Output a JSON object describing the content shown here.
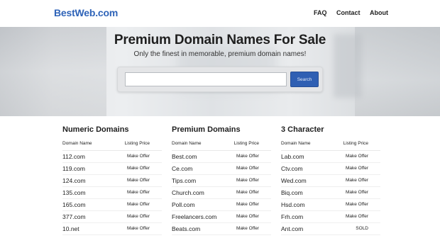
{
  "nav": {
    "logo": "BestWeb.com",
    "links": [
      "FAQ",
      "Contact",
      "About"
    ]
  },
  "hero": {
    "title": "Premium Domain Names For Sale",
    "subtitle": "Only the finest in memorable, premium domain names!",
    "search": {
      "value": "",
      "placeholder": "",
      "button": "Search"
    }
  },
  "columns": [
    {
      "title": "Numeric Domains",
      "header": {
        "name": "Domain Name",
        "price": "Listing Price"
      },
      "rows": [
        {
          "name": "112.com",
          "price": "Make Offer"
        },
        {
          "name": "119.com",
          "price": "Make Offer"
        },
        {
          "name": "124.com",
          "price": "Make Offer"
        },
        {
          "name": "135.com",
          "price": "Make Offer"
        },
        {
          "name": "165.com",
          "price": "Make Offer"
        },
        {
          "name": "377.com",
          "price": "Make Offer"
        },
        {
          "name": "10.net",
          "price": "Make Offer"
        }
      ]
    },
    {
      "title": "Premium Domains",
      "header": {
        "name": "Domain Name",
        "price": "Listing Price"
      },
      "rows": [
        {
          "name": "Best.com",
          "price": "Make Offer"
        },
        {
          "name": "Ce.com",
          "price": "Make Offer"
        },
        {
          "name": "Tips.com",
          "price": "Make Offer"
        },
        {
          "name": "Church.com",
          "price": "Make Offer"
        },
        {
          "name": "Poll.com",
          "price": "Make Offer"
        },
        {
          "name": "Freelancers.com",
          "price": "Make Offer"
        },
        {
          "name": "Beats.com",
          "price": "Make Offer"
        }
      ]
    },
    {
      "title": "3 Character",
      "header": {
        "name": "Domain Name",
        "price": "Listing Price"
      },
      "rows": [
        {
          "name": "Lab.com",
          "price": "Make Offer"
        },
        {
          "name": "Ctv.com",
          "price": "Make Offer"
        },
        {
          "name": "Wed.com",
          "price": "Make Offer"
        },
        {
          "name": "Biq.com",
          "price": "Make Offer"
        },
        {
          "name": "Hsd.com",
          "price": "Make Offer"
        },
        {
          "name": "Frh.com",
          "price": "Make Offer"
        },
        {
          "name": "Ant.com",
          "price": "SOLD"
        }
      ]
    }
  ],
  "colors": {
    "brand": "#2e63b8",
    "button": "#2f5fb3"
  }
}
